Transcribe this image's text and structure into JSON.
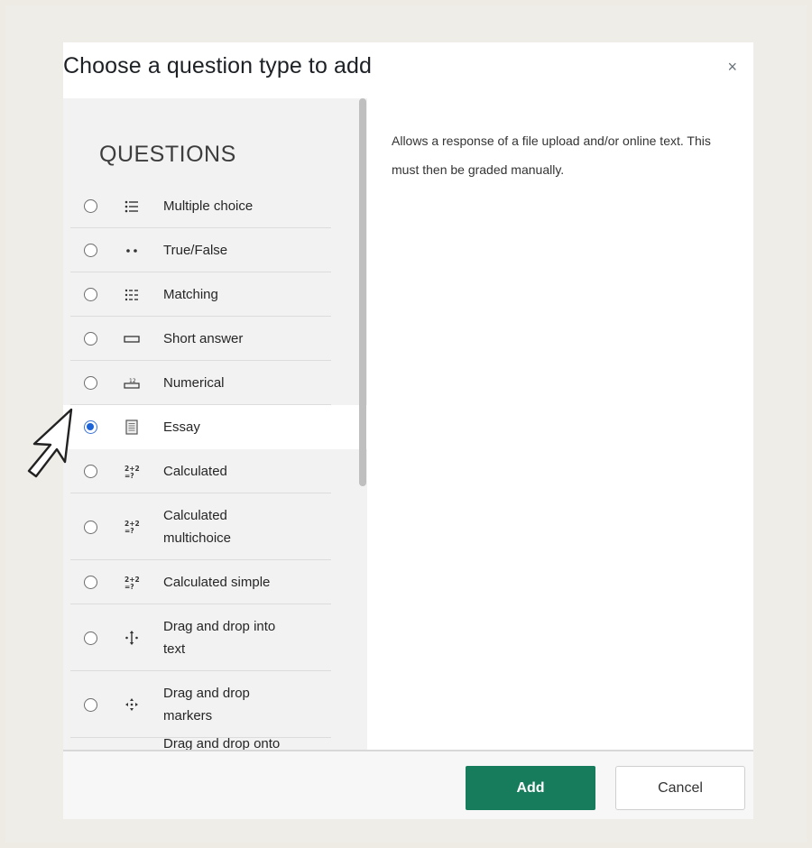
{
  "dialog": {
    "title": "Choose a question type to add",
    "close_label": "×"
  },
  "sidebar": {
    "heading": "QUESTIONS",
    "items": [
      {
        "label": "Multiple choice",
        "icon": "list-icon",
        "selected": false
      },
      {
        "label": "True/False",
        "icon": "two-dots-icon",
        "selected": false
      },
      {
        "label": "Matching",
        "icon": "matching-grid-icon",
        "selected": false
      },
      {
        "label": "Short answer",
        "icon": "textbox-icon",
        "selected": false
      },
      {
        "label": "Numerical",
        "icon": "numerical-icon",
        "selected": false
      },
      {
        "label": "Essay",
        "icon": "document-icon",
        "selected": true
      },
      {
        "label": "Calculated",
        "icon": "calculated-icon",
        "glyph": "2+2 =?",
        "selected": false
      },
      {
        "label": "Calculated multichoice",
        "icon": "calculated-multichoice-icon",
        "glyph": "2+2 =?",
        "selected": false
      },
      {
        "label": "Calculated simple",
        "icon": "calculated-simple-icon",
        "glyph": "2+2 =?",
        "selected": false
      },
      {
        "label": "Drag and drop into text",
        "icon": "drag-into-text-icon",
        "selected": false
      },
      {
        "label": "Drag and drop markers",
        "icon": "drag-markers-icon",
        "selected": false
      },
      {
        "label": "Drag and drop onto",
        "icon": "drag-onto-image-icon",
        "selected": false
      }
    ]
  },
  "description": "Allows a response of a file upload and/or online text. This must then be graded manually.",
  "footer": {
    "add_label": "Add",
    "cancel_label": "Cancel"
  },
  "colors": {
    "add_button": "#177c5c",
    "selected_radio": "#1a63d8"
  }
}
